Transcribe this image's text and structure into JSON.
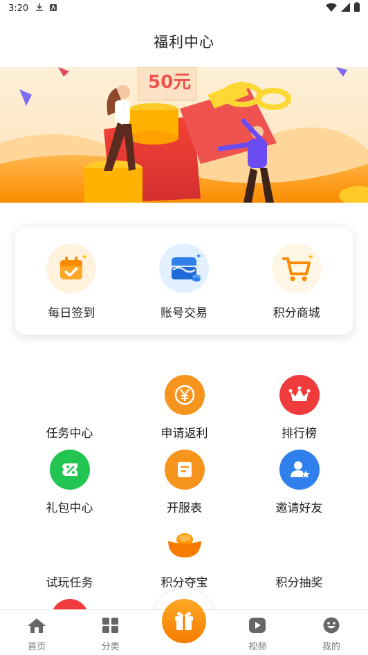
{
  "status_bar": {
    "time": "3:20"
  },
  "header": {
    "title": "福利中心"
  },
  "banner": {
    "amount_text": "50元"
  },
  "quick_actions": [
    {
      "label": "每日签到",
      "icon": "calendar-check-icon"
    },
    {
      "label": "账号交易",
      "icon": "trade-icon"
    },
    {
      "label": "积分商城",
      "icon": "cart-icon"
    }
  ],
  "grid": [
    {
      "label": "任务中心",
      "icon": ""
    },
    {
      "label": "申请返利",
      "icon": "yen-coin-icon",
      "color": "#f7941d"
    },
    {
      "label": "排行榜",
      "icon": "crown-icon",
      "color": "#ef3b3b"
    },
    {
      "label": "礼包中心",
      "icon": "percent-icon",
      "color": "#23c552"
    },
    {
      "label": "开服表",
      "icon": "notepad-icon",
      "color": "#f7941d"
    },
    {
      "label": "邀请好友",
      "icon": "user-star-icon",
      "color": "#2f80ed"
    },
    {
      "label": "试玩任务",
      "icon": ""
    },
    {
      "label": "积分夺宝",
      "icon": "gold-ingot-icon",
      "color": "#f57c00"
    },
    {
      "label": "积分抽奖",
      "icon": ""
    }
  ],
  "bottom_nav": {
    "items": [
      {
        "label": "首页",
        "icon": "home-icon"
      },
      {
        "label": "分类",
        "icon": "grid-icon"
      },
      {
        "label": "",
        "icon": "gift-icon"
      },
      {
        "label": "视频",
        "icon": "play-icon"
      },
      {
        "label": "我的",
        "icon": "smile-icon"
      }
    ]
  },
  "colors": {
    "accent": "#f7941d",
    "red": "#ef3b3b",
    "green": "#23c552",
    "blue": "#2f80ed",
    "nav_text": "#777777"
  }
}
